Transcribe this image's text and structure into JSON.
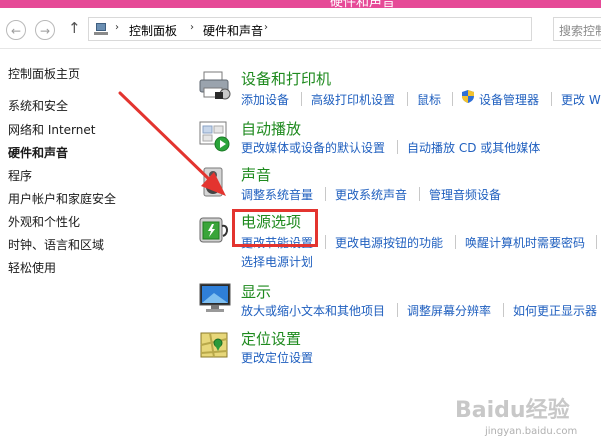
{
  "window": {
    "title": "硬件和声音"
  },
  "nav": {
    "back_label": "←",
    "forward_label": "→",
    "up_label": "↑",
    "breadcrumbs": [
      "控制面板",
      "硬件和声音"
    ],
    "separator": "›",
    "dropdown": "∨",
    "search_placeholder": "搜索控制面"
  },
  "sidebar": {
    "items": [
      {
        "label": "控制面板主页",
        "active": false
      },
      {
        "label": "系统和安全",
        "active": false
      },
      {
        "label": "网络和 Internet",
        "active": false
      },
      {
        "label": "硬件和声音",
        "active": true
      },
      {
        "label": "程序",
        "active": false
      },
      {
        "label": "用户帐户和家庭安全",
        "active": false
      },
      {
        "label": "外观和个性化",
        "active": false
      },
      {
        "label": "时钟、语言和区域",
        "active": false
      },
      {
        "label": "轻松使用",
        "active": false
      }
    ]
  },
  "categories": {
    "devices": {
      "title": "设备和打印机",
      "links": [
        "添加设备",
        "高级打印机设置",
        "鼠标",
        "设备管理器",
        "更改 W"
      ]
    },
    "autoplay": {
      "title": "自动播放",
      "links": [
        "更改媒体或设备的默认设置",
        "自动播放 CD 或其他媒体"
      ]
    },
    "sound": {
      "title": "声音",
      "links": [
        "调整系统音量",
        "更改系统声音",
        "管理音频设备"
      ]
    },
    "power": {
      "title": "电源选项",
      "links": [
        "更改节能设置",
        "更改电源按钮的功能",
        "唤醒计算机时需要密码",
        "选择电源计划"
      ]
    },
    "display": {
      "title": "显示",
      "links": [
        "放大或缩小文本和其他项目",
        "调整屏幕分辨率",
        "如何更正显示器"
      ]
    },
    "location": {
      "title": "定位设置",
      "links": [
        "更改定位设置"
      ]
    }
  },
  "watermark": {
    "brand": "Baidu经验",
    "url": "jingyan.baidu.com"
  },
  "colors": {
    "title_bar": "#e64a97",
    "category_title": "#1e8a1e",
    "link": "#1f5fbf",
    "highlight": "#e3342f",
    "arrow": "#e3342f"
  }
}
